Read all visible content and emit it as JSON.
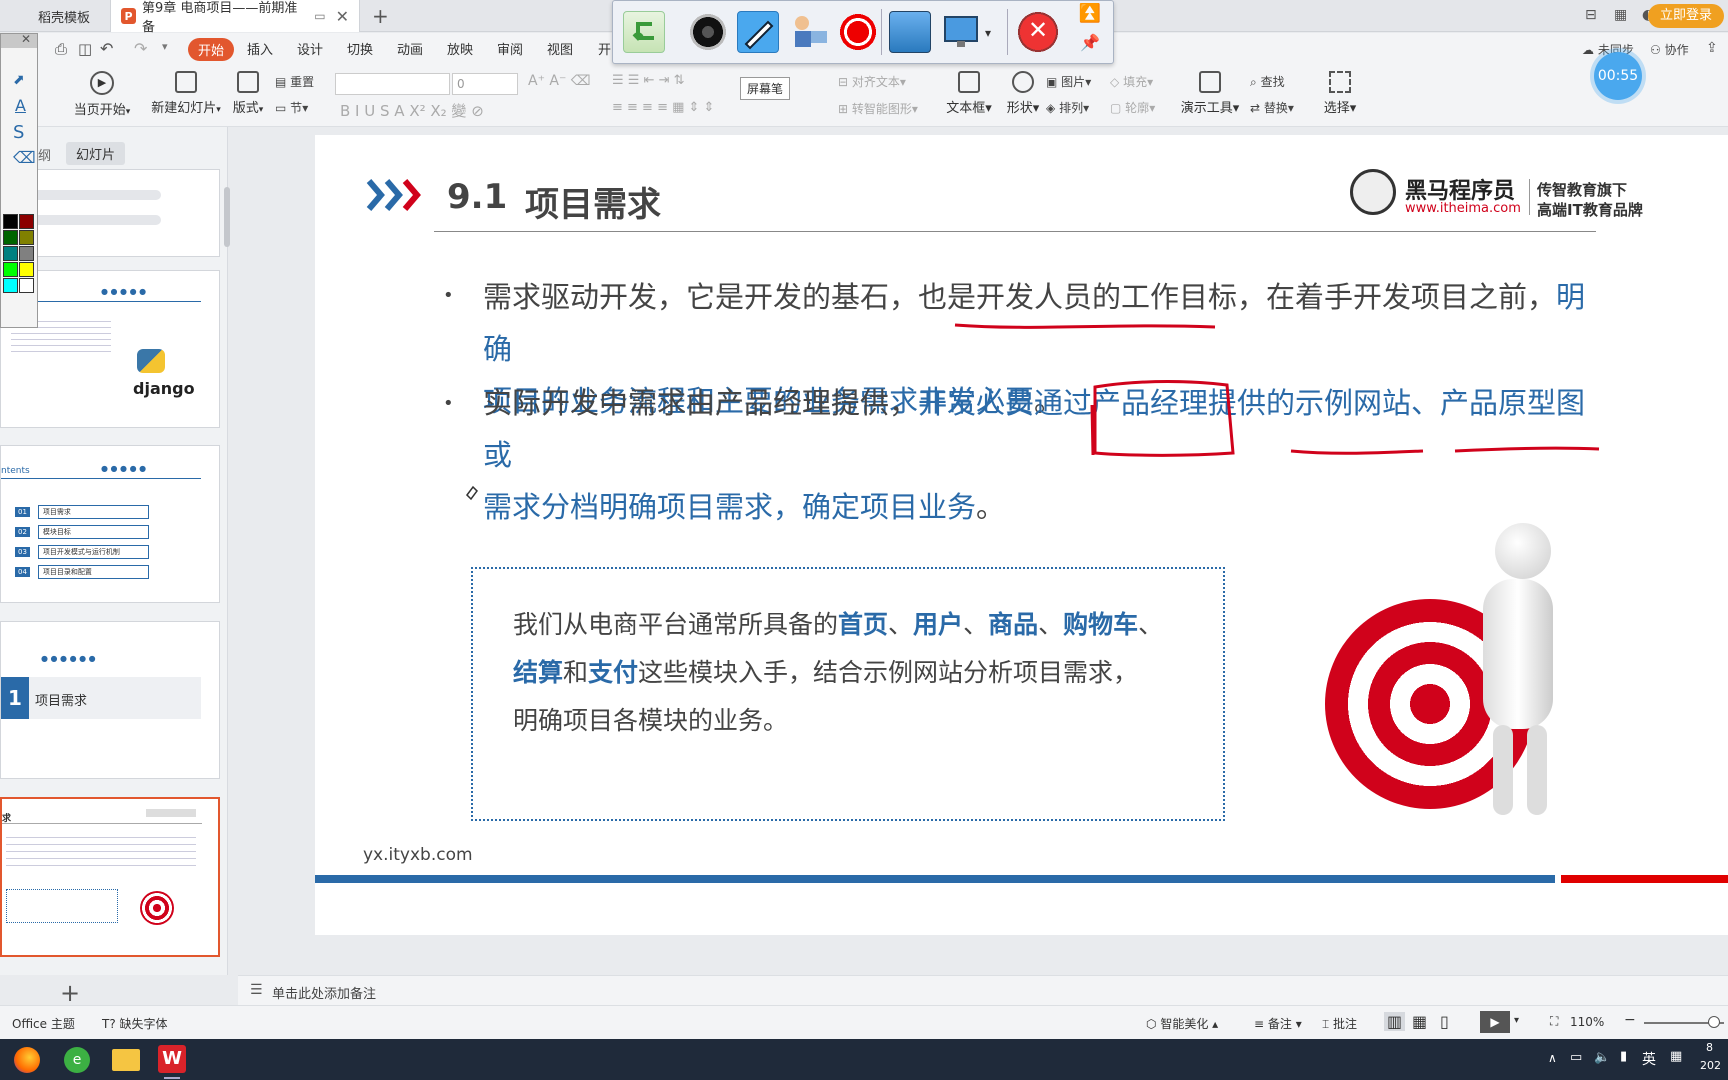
{
  "tabs": {
    "tab1": "稻壳模板",
    "tab2": "第9章 电商项目——前期准备",
    "login": "立即登录"
  },
  "menu": {
    "start": "开始",
    "items": [
      "插入",
      "设计",
      "切换",
      "动画",
      "放映",
      "审阅",
      "视图",
      "开"
    ],
    "right_collab": "协作",
    "right_unsaved": "未同步"
  },
  "ribbon": {
    "from_current": "当页开始",
    "new_slide": "新建幻灯片",
    "layout": "版式",
    "reset": "重置",
    "section": "节",
    "font_size": "0",
    "align_text": "对齐文本",
    "smart_shape": "转智能图形",
    "textbox": "文本框",
    "shape": "形状",
    "picture": "图片",
    "fill": "填充",
    "arrange": "排列",
    "outline": "轮廓",
    "present_tools": "演示工具",
    "find": "查找",
    "replace": "替换",
    "select": "选择",
    "screen_pen_tooltip": "屏幕笔"
  },
  "timer": "00:55",
  "left_panel": {
    "tab_outline": "纲",
    "tab_slides": "幻灯片",
    "thumb2_text": "django",
    "thumb3_items": [
      "项目需求",
      "模块目标",
      "项目开发模式与运行机制",
      "项目目录和配置"
    ],
    "thumb3_nums": [
      "01",
      "02",
      "03",
      "04"
    ],
    "thumb3_title": "ntents",
    "thumb4_title": "项目需求",
    "thumb4_num": "1",
    "thumb5_title": "求"
  },
  "slide": {
    "title_num": "9.1",
    "title": "项目需求",
    "brand_name": "黑马程序员",
    "brand_url": "www.itheima.com",
    "brand_slogan1": "传智教育旗下",
    "brand_slogan2": "高端IT教育品牌",
    "bullet1_a": "需求驱动开发，它是开发的基石，也是开发人员的工作目标，在着手开发项目之前，",
    "bullet1_b": "明确",
    "bullet1_c": "项目的业务流程和主要的业务需求非常必要",
    "bullet1_d": "。",
    "bullet2_a": "实际开发中需求由产品经理提供，",
    "bullet2_b": "开发人员通过产品经理提供的示例网站、产品原型图或",
    "bullet2_c": "需求分档明确项目需求，确定项目业务",
    "bullet2_d": "。",
    "box": {
      "p1": "我们从电商平台通常所具备的",
      "k1": "首页",
      "s1": "、",
      "k2": "用户",
      "s2": "、",
      "k3": "商品",
      "s3": "、",
      "k4": "购物车",
      "s4": "、",
      "k5": "结算",
      "s5": "和",
      "k6": "支付",
      "p2": "这些模块入手，结合示例网站分析项目需求，",
      "p3": "明确项目各模块的业务。"
    },
    "footer_url": "yx.ityxb.com"
  },
  "notes_placeholder": "单击此处添加备注",
  "status": {
    "theme": "Office 主题",
    "missing_font": "缺失字体",
    "beautify": "智能美化",
    "notes": "备注",
    "comment": "批注",
    "zoom": "110%"
  },
  "taskbar": {
    "ime": "英",
    "clock_line1": "8",
    "clock_line2": "202"
  },
  "colors": {
    "accent": "#e2572e",
    "blue_text": "#2a6aa8",
    "annotation_red": "#d0021b"
  }
}
